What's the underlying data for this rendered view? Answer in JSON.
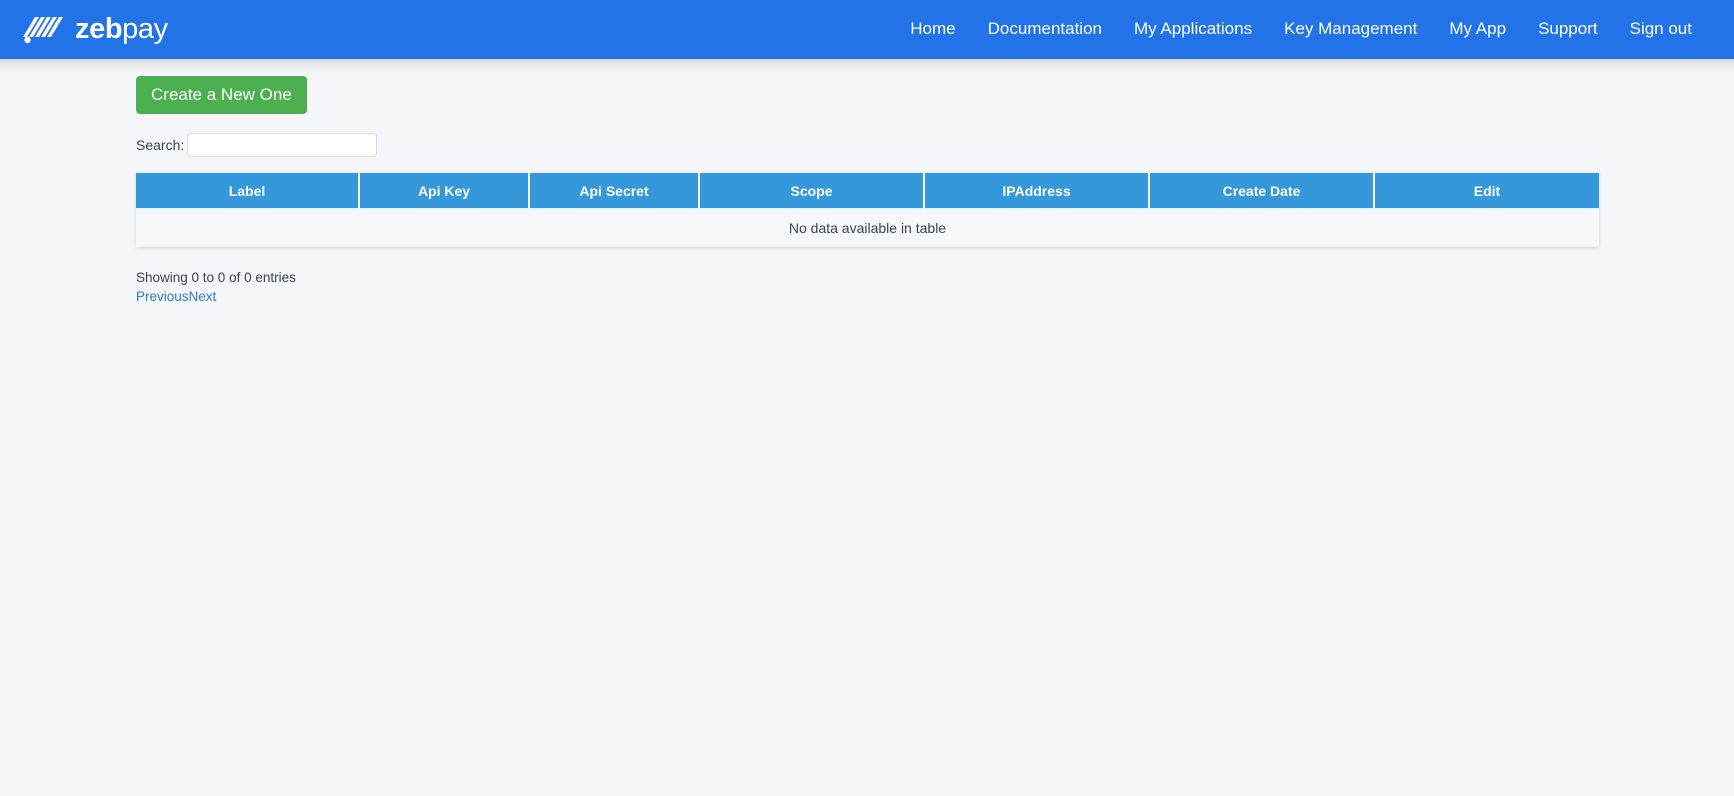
{
  "brand": {
    "name_bold": "zeb",
    "name_light": "pay",
    "icon": "zebpay-stripes-logo-icon",
    "color": "#ffffff"
  },
  "navbar": {
    "background": "#2272e8",
    "links": [
      {
        "label": "Home"
      },
      {
        "label": "Documentation"
      },
      {
        "label": "My Applications"
      },
      {
        "label": "Key Management"
      },
      {
        "label": "My App"
      },
      {
        "label": "Support"
      },
      {
        "label": "Sign out"
      }
    ]
  },
  "toolbar": {
    "create_label": "Create a New One",
    "create_color": "#4caf50"
  },
  "search": {
    "label": "Search:",
    "value": "",
    "placeholder": ""
  },
  "table": {
    "header_color": "#3498db",
    "columns": [
      {
        "label": "Label"
      },
      {
        "label": "Api Key"
      },
      {
        "label": "Api Secret"
      },
      {
        "label": "Scope"
      },
      {
        "label": "IPAddress"
      },
      {
        "label": "Create Date"
      },
      {
        "label": "Edit"
      }
    ],
    "rows": [],
    "empty_message": "No data available in table"
  },
  "footer": {
    "info": "Showing 0 to 0 of 0 entries",
    "previous_label": "Previous",
    "next_label": "Next"
  }
}
